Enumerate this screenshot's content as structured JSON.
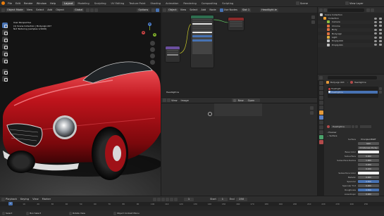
{
  "topbar": {
    "menus": [
      "File",
      "Edit",
      "Render",
      "Window",
      "Help"
    ],
    "workspace_tabs": [
      "Layout",
      "Modeling",
      "Sculpting",
      "UV Editing",
      "Texture Paint",
      "Shading",
      "Animation",
      "Rendering",
      "Compositing",
      "Scripting"
    ],
    "active_tab": "Layout",
    "scene_label": "Scene",
    "view_layer_label": "View Layer"
  },
  "viewport": {
    "mode_label": "Object Mode",
    "menus": [
      "View",
      "Select",
      "Add",
      "Object"
    ],
    "orientation_label": "Global",
    "options_label": "Options",
    "overlay_line1": "User Perspective",
    "overlay_line2": "(1) Scene Collection | Body.sign.007",
    "overlay_line3": "Not Texturing (samples 1/1000)",
    "light_label": "Headlight.le"
  },
  "node_editor": {
    "menus": [
      "Object",
      "View",
      "Select",
      "Add",
      "Node"
    ],
    "use_nodes_label": "Use Nodes",
    "slot_label": "Slot 1",
    "material_label": "Headlight.le"
  },
  "image_editor": {
    "menus": [
      "View",
      "Image"
    ],
    "new_label": "New",
    "open_label": "Open"
  },
  "timeline": {
    "menus": [
      "Playback",
      "Keying",
      "View",
      "Marker"
    ],
    "start_label": "Start",
    "start_value": "1",
    "end_label": "End",
    "end_value": "250",
    "current_frame": "1",
    "ruler": [
      "0",
      "10",
      "20",
      "30",
      "40",
      "50",
      "60",
      "70",
      "80",
      "90",
      "100",
      "110",
      "120",
      "130",
      "140",
      "150",
      "160",
      "170",
      "180",
      "190",
      "200",
      "210",
      "220",
      "230",
      "240",
      "250"
    ]
  },
  "outliner": {
    "title": "Scene Collection",
    "items": [
      {
        "name": "Collection",
        "color": "#f0a030",
        "indent": 1
      },
      {
        "name": "Camera",
        "color": "#8fbf3f",
        "indent": 2
      },
      {
        "name": "Chrome",
        "color": "#e07040",
        "indent": 2
      },
      {
        "name": "Body",
        "color": "#e07040",
        "indent": 2
      },
      {
        "name": "Body.sign",
        "color": "#e07040",
        "indent": 2
      },
      {
        "name": "Light",
        "color": "#e0b040",
        "indent": 2
      },
      {
        "name": "Empty.000",
        "color": "#c0c0c0",
        "indent": 2
      },
      {
        "name": "Empty.001",
        "color": "#c0c0c0",
        "indent": 2
      }
    ]
  },
  "properties": {
    "object_label": "Body.sign.003",
    "material_label": "Headlight.le",
    "slots": [
      "Headlight",
      "Headlight.le"
    ],
    "active_slot": "Headlight.le",
    "material_field": "Headlight.le",
    "sections": [
      "Preview",
      "Surface"
    ],
    "surface_label": "Surface",
    "surface_value": "Principled BSDF",
    "distribution_value": "GGX",
    "subsurface_method_value": "Christensen-Burley",
    "rows": [
      {
        "label": "Base Color",
        "value": "",
        "style": "white"
      },
      {
        "label": "Subsurface",
        "value": "0.000",
        "style": ""
      },
      {
        "label": "Subsurface Radius",
        "value": "1.000",
        "style": ""
      },
      {
        "label": "",
        "value": "0.200",
        "style": ""
      },
      {
        "label": "",
        "value": "0.100",
        "style": ""
      },
      {
        "label": "Subsurface Color",
        "value": "",
        "style": "white"
      },
      {
        "label": "Metallic",
        "value": "0.000",
        "style": ""
      },
      {
        "label": "Specular",
        "value": "0.500",
        "style": "blue"
      },
      {
        "label": "Specular Tint",
        "value": "0.000",
        "style": ""
      },
      {
        "label": "Roughness",
        "value": "0.500",
        "style": "blue"
      },
      {
        "label": "Anisotropic",
        "value": "0.000",
        "style": ""
      },
      {
        "label": "Anisotropic Rotation",
        "value": "0.000",
        "style": ""
      },
      {
        "label": "Sheen",
        "value": "0.000",
        "style": ""
      }
    ]
  },
  "statusbar": {
    "left": "Select",
    "middle": "Box Select",
    "center": "Rotate View",
    "right": "Object Context Menu"
  },
  "colors": {
    "accent_blue": "#4772b3",
    "car_red": "#b21219",
    "node_header_shader": "#2e6d4f",
    "node_header_output": "#8a2a2a",
    "node_header_texture": "#6b4f9e"
  }
}
